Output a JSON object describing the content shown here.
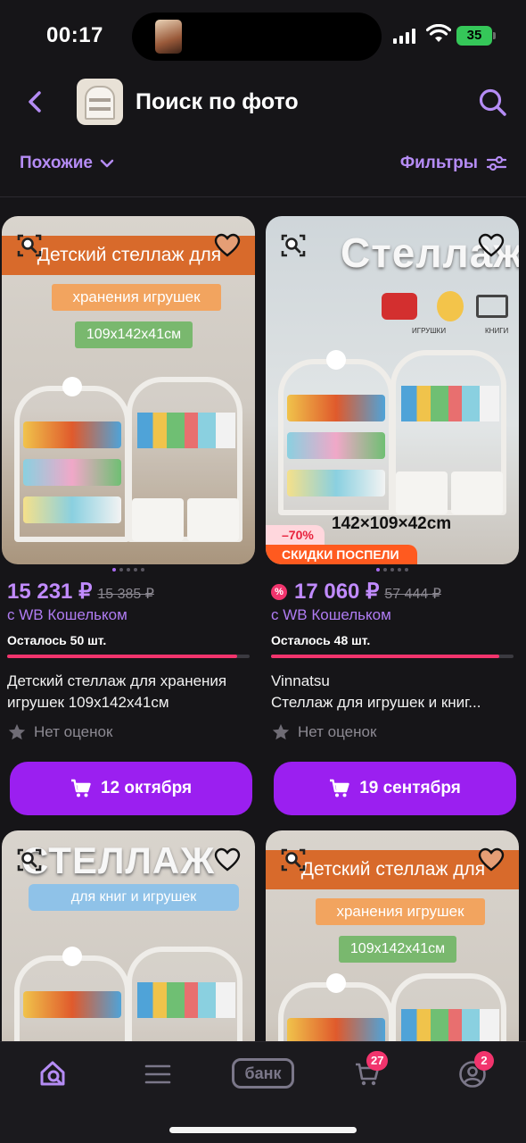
{
  "status_bar": {
    "time": "00:17",
    "battery": "35"
  },
  "header": {
    "title": "Поиск по фото"
  },
  "filters": {
    "similar_label": "Похожие",
    "filters_label": "Фильтры"
  },
  "products": [
    {
      "image_banner": "Детский стеллаж для",
      "image_sub": "хранения игрушек",
      "image_size": "109x142x41см",
      "price": "15 231 ₽",
      "old_price": "15 385 ₽",
      "wallet": "с WB Кошельком",
      "stock": "Осталось 50 шт.",
      "stock_fill": 0.95,
      "name_line1": "Детский стеллаж для хранения",
      "name_line2": "игрушек 109x142x41см",
      "rating": "Нет оценок",
      "delivery": "12 октября"
    },
    {
      "image_title": "Стеллаж",
      "image_dims": "142×109×42cm",
      "image_toy1": "ИГРУШКИ",
      "image_toy2": "КНИГИ",
      "discount": "–70%",
      "sale_label": "СКИДКИ ПОСПЕЛИ",
      "price": "17 060 ₽",
      "old_price": "57 444 ₽",
      "wallet_badge": "%",
      "wallet": "с WB Кошельком",
      "stock": "Осталось 48 шт.",
      "stock_fill": 0.94,
      "name_line1": "Vinnatsu",
      "name_line2": "Стеллаж для игрушек и книг...",
      "rating": "Нет оценок",
      "delivery": "19 сентября"
    },
    {
      "image_title": "СТЕЛЛАЖ",
      "image_sub": "для книг и игрушек"
    },
    {
      "image_banner": "Детский стеллаж для",
      "image_sub": "хранения игрушек",
      "image_size": "109x142x41см"
    }
  ],
  "tabbar": {
    "bank_label": "банк",
    "cart_badge": "27",
    "profile_badge": "2"
  },
  "colors": {
    "accent": "#9b1ff0",
    "price": "#c18bff",
    "badge": "#f2346d"
  }
}
